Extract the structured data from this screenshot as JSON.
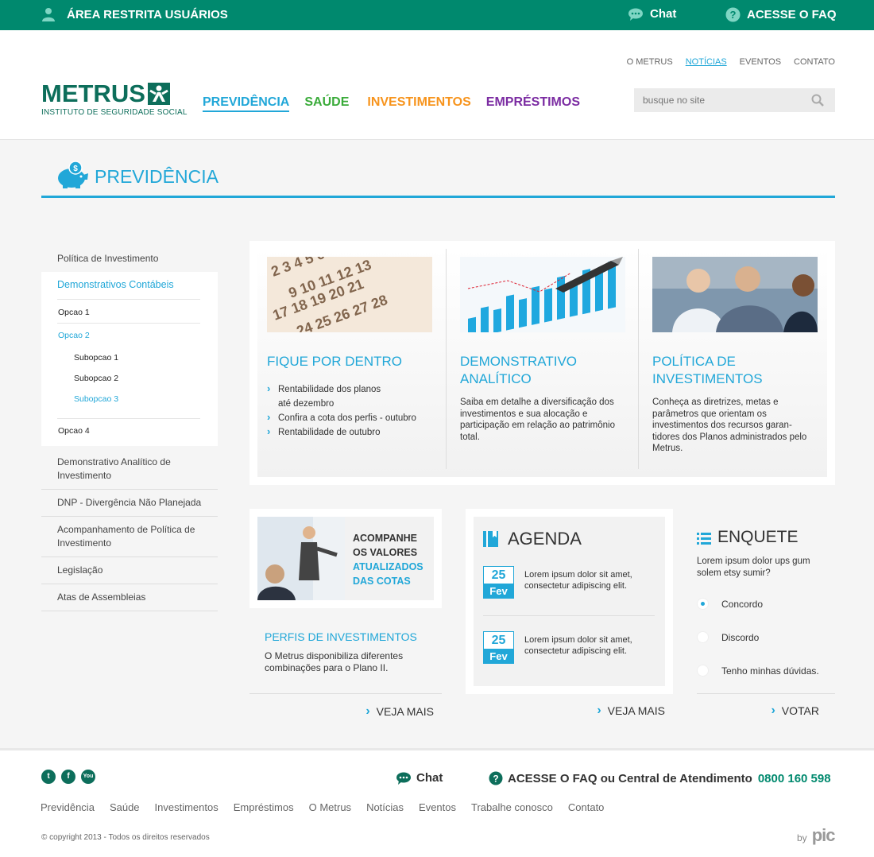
{
  "topbar": {
    "restricted_label": "ÁREA RESTRITA USUÁRIOS",
    "chat_label": "Chat",
    "faq_label": "ACESSE O FAQ"
  },
  "header": {
    "top_links": [
      {
        "label": "O METRUS",
        "active": false
      },
      {
        "label": "NOTÍCIAS",
        "active": true
      },
      {
        "label": "EVENTOS",
        "active": false
      },
      {
        "label": "CONTATO",
        "active": false
      }
    ],
    "logo": {
      "name": "METRUS",
      "subtitle": "INSTITUTO DE SEGURIDADE SOCIAL"
    },
    "nav": [
      "PREVIDÊNCIA",
      "SAÚDE",
      "INVESTIMENTOS",
      "EMPRÉSTIMOS"
    ],
    "search_placeholder": "busque no site"
  },
  "page": {
    "title": "PREVIDÊNCIA"
  },
  "sidebar": {
    "first": "Política de Investimento",
    "active_section": "Demonstrativos Contábeis",
    "option1": "Opcao 1",
    "option2": "Opcao 2",
    "subs": [
      "Subopcao 1",
      "Subopcao 2",
      "Subopcao 3"
    ],
    "option4": "Opcao 4",
    "items": [
      "Demonstrativo Analítico de Investimento",
      "DNP - Divergência Não Planejada",
      "Acompanhamento de Política de Investimento",
      "Legislação",
      "Atas de Assembleias"
    ]
  },
  "features": [
    {
      "title": "FIQUE POR DENTRO",
      "bullets": [
        "Rentabilidade dos planos até dezembro",
        "Confira a cota dos perfis - outubro",
        "Rentabilidade de outubro"
      ]
    },
    {
      "title": "DEMONSTRATIVO ANALÍTICO",
      "text": "Saiba em detalhe a diversificação dos investimentos e sua alocação e participação em relação ao patrimônio total."
    },
    {
      "title": "POLÍTICA DE INVESTIMENTOS",
      "text": "Conheça as diretrizes, metas e parâmetros que orientam os investimentos dos recursos garan-tidores dos Planos administrados pelo Metrus."
    }
  ],
  "cotas": {
    "line1": "ACOMPANHE",
    "line2": "OS VALORES",
    "line3": "ATUALIZADOS",
    "line4": "DAS COTAS"
  },
  "perfis": {
    "title": "PERFIS DE INVESTIMENTOS",
    "text": "O Metrus disponibiliza diferentes combinações para o Plano II."
  },
  "veja_mais": "VEJA MAIS",
  "agenda": {
    "title": "AGENDA",
    "events": [
      {
        "day": "25",
        "month": "Fev",
        "text": "Lorem ipsum dolor sit amet, consectetur adipiscing elit."
      },
      {
        "day": "25",
        "month": "Fev",
        "text": "Lorem ipsum dolor sit amet, consectetur adipiscing elit."
      }
    ]
  },
  "enquete": {
    "title": "ENQUETE",
    "question": "Lorem ipsum dolor ups gum solem etsy sumir?",
    "options": [
      "Concordo",
      "Discordo",
      "Tenho minhas dúvidas."
    ],
    "selected": 0,
    "vote_label": "VOTAR"
  },
  "footer": {
    "chat_label": "Chat",
    "faq_label": "ACESSE O FAQ ou Central de Atendimento",
    "phone": "0800 160 598",
    "nav": [
      "Previdência",
      "Saúde",
      "Investimentos",
      "Empréstimos",
      "O Metrus",
      "Notícias",
      "Eventos",
      "Trabalhe conosco",
      "Contato"
    ],
    "copyright": "© copyright 2013 - Todos os direitos reservados",
    "by": "by",
    "credit": "pic"
  },
  "colors": {
    "brand_green": "#00896e",
    "accent_blue": "#21a7d8",
    "saude_green": "#3aab3a",
    "investimentos_orange": "#f7941d",
    "emprestimos_purple": "#7b2ca2"
  }
}
